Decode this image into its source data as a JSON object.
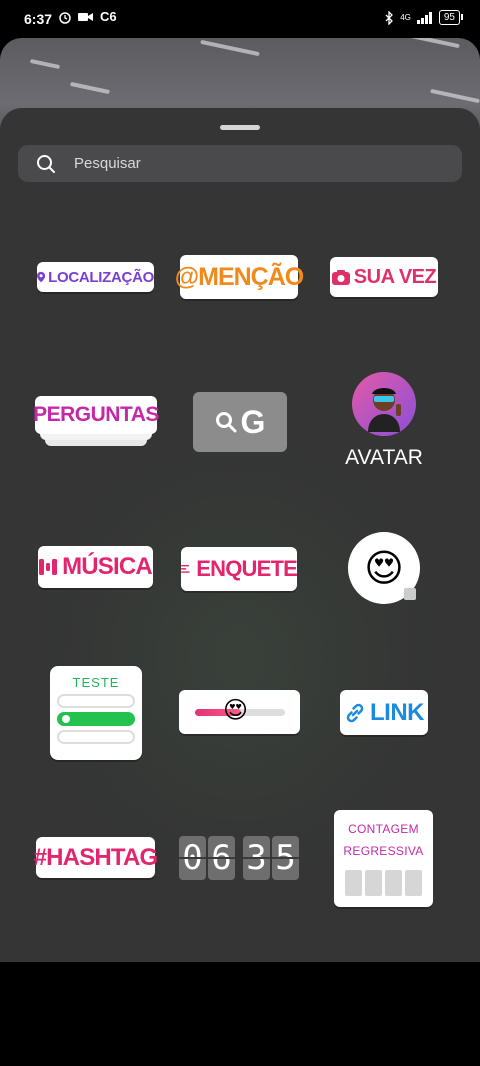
{
  "status_bar": {
    "time": "6:37",
    "carrier_badge": "C6",
    "battery": "95",
    "network": "4G"
  },
  "search": {
    "placeholder": "Pesquisar"
  },
  "stickers": {
    "localizacao": "LOCALIZAÇÃO",
    "mencao": "@MENÇÃO",
    "sua_vez": "SUA VEZ",
    "perguntas": "PERGUNTAS",
    "gif": "G",
    "avatar": "AVATAR",
    "musica": "MÚSICA",
    "enquete": "ENQUETE",
    "emoji": "😍",
    "teste": "TESTE",
    "slider_emoji": "😍",
    "link": "LINK",
    "hashtag": "#HASHTAG",
    "clock_digits": [
      "0",
      "6",
      "3",
      "5"
    ],
    "contagem": "CONTAGEM",
    "regressiva": "REGRESSIVA"
  },
  "colors": {
    "sheet": "#353536",
    "localizacao": "#7a3fd0",
    "mencao": "#f08a1c",
    "pink": "#e3246e",
    "link": "#1c8adf",
    "teste": "#1fb65a"
  }
}
